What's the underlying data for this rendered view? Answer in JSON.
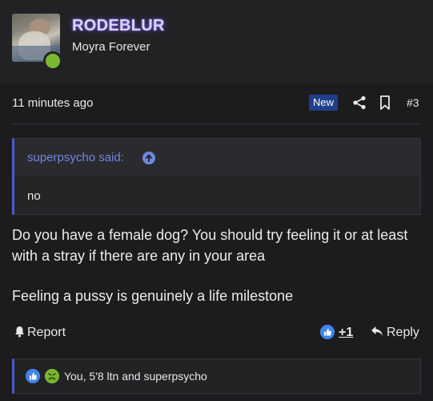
{
  "author": {
    "username": "RODEBLUR",
    "title": "Moyra Forever",
    "status": "online"
  },
  "meta": {
    "time": "11 minutes ago",
    "badge": "New",
    "post_number": "#3",
    "icons": [
      "share-icon",
      "bookmark-icon"
    ]
  },
  "quote": {
    "author": "superpsycho said:",
    "body": "no",
    "icon": "arrow-up-circle-icon"
  },
  "post": {
    "paragraphs": [
      "Do you have a female dog? You should try feeling it or at least with a stray if there are any in your area",
      "Feeling a pussy is genuinely a life milestone"
    ]
  },
  "actions": {
    "report_label": "Report",
    "like_count": "+1",
    "reply_label": "Reply"
  },
  "reactions": {
    "text": "You, 5'8 ltn and superpsycho",
    "icons": [
      "like-reaction-icon",
      "sick-reaction-icon"
    ]
  },
  "colors": {
    "background": "#1c1c1e",
    "accent": "#4a5bd0",
    "link": "#6f86e0",
    "online": "#7cb82f",
    "badge": "#1f3f8a",
    "like": "#3f86e8"
  }
}
